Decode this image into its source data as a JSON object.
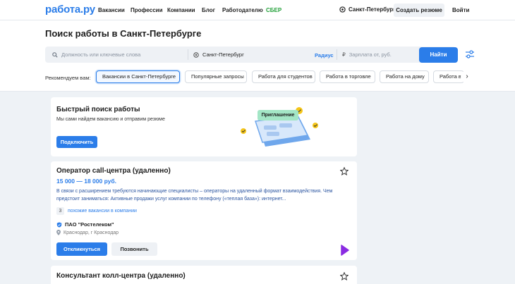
{
  "header": {
    "logo": "работа.ру",
    "nav": [
      "Вакансии",
      "Профессии",
      "Компании",
      "Блог",
      "Работодателю",
      "СБЕР"
    ],
    "city": "Санкт-Петербург",
    "create_resume": "Создать резюме",
    "login": "Войти"
  },
  "search": {
    "title": "Поиск работы в Санкт-Петербурге",
    "query_placeholder": "Должность или ключевые слова",
    "city_value": "Санкт-Петербург",
    "radius_label": "Радиус",
    "salary_placeholder": "Зарплата от, руб.",
    "find_button": "Найти",
    "recommend_label": "Рекомендуем вам:",
    "chips": [
      "Вакансии в Санкт-Петербурге",
      "Популярные запросы",
      "Работа для студентов",
      "Работа в торговле",
      "Работа на дому",
      "Работа в"
    ]
  },
  "quick_search": {
    "title": "Быстрый поиск работы",
    "subtitle": "Мы сами найдем вакансию и отправим резюме",
    "button": "Подключить",
    "badge": "Приглашение"
  },
  "jobs": [
    {
      "title": "Оператор call-центра (удаленно)",
      "salary": "15 000 — 18 000 руб.",
      "description": "В связи с расширением требуются начинающие специалисты – операторы на удаленный формат взаимодействия. Чем предстоит заниматься: Активные продажи услуг компании по телефону («теплая база»): интернет...",
      "similar_count": "3",
      "similar_text": "похожие вакансии в компании",
      "company": "ПАО \"Ростелеком\"",
      "address": "Краснодар, г Краснодар",
      "respond": "Откликнуться",
      "call": "Позвонить"
    },
    {
      "title": "Консультант колл-центра (удаленно)"
    }
  ],
  "colors": {
    "accent": "#2b7de9",
    "sber": "#21a038",
    "background": "#eef2f6"
  }
}
